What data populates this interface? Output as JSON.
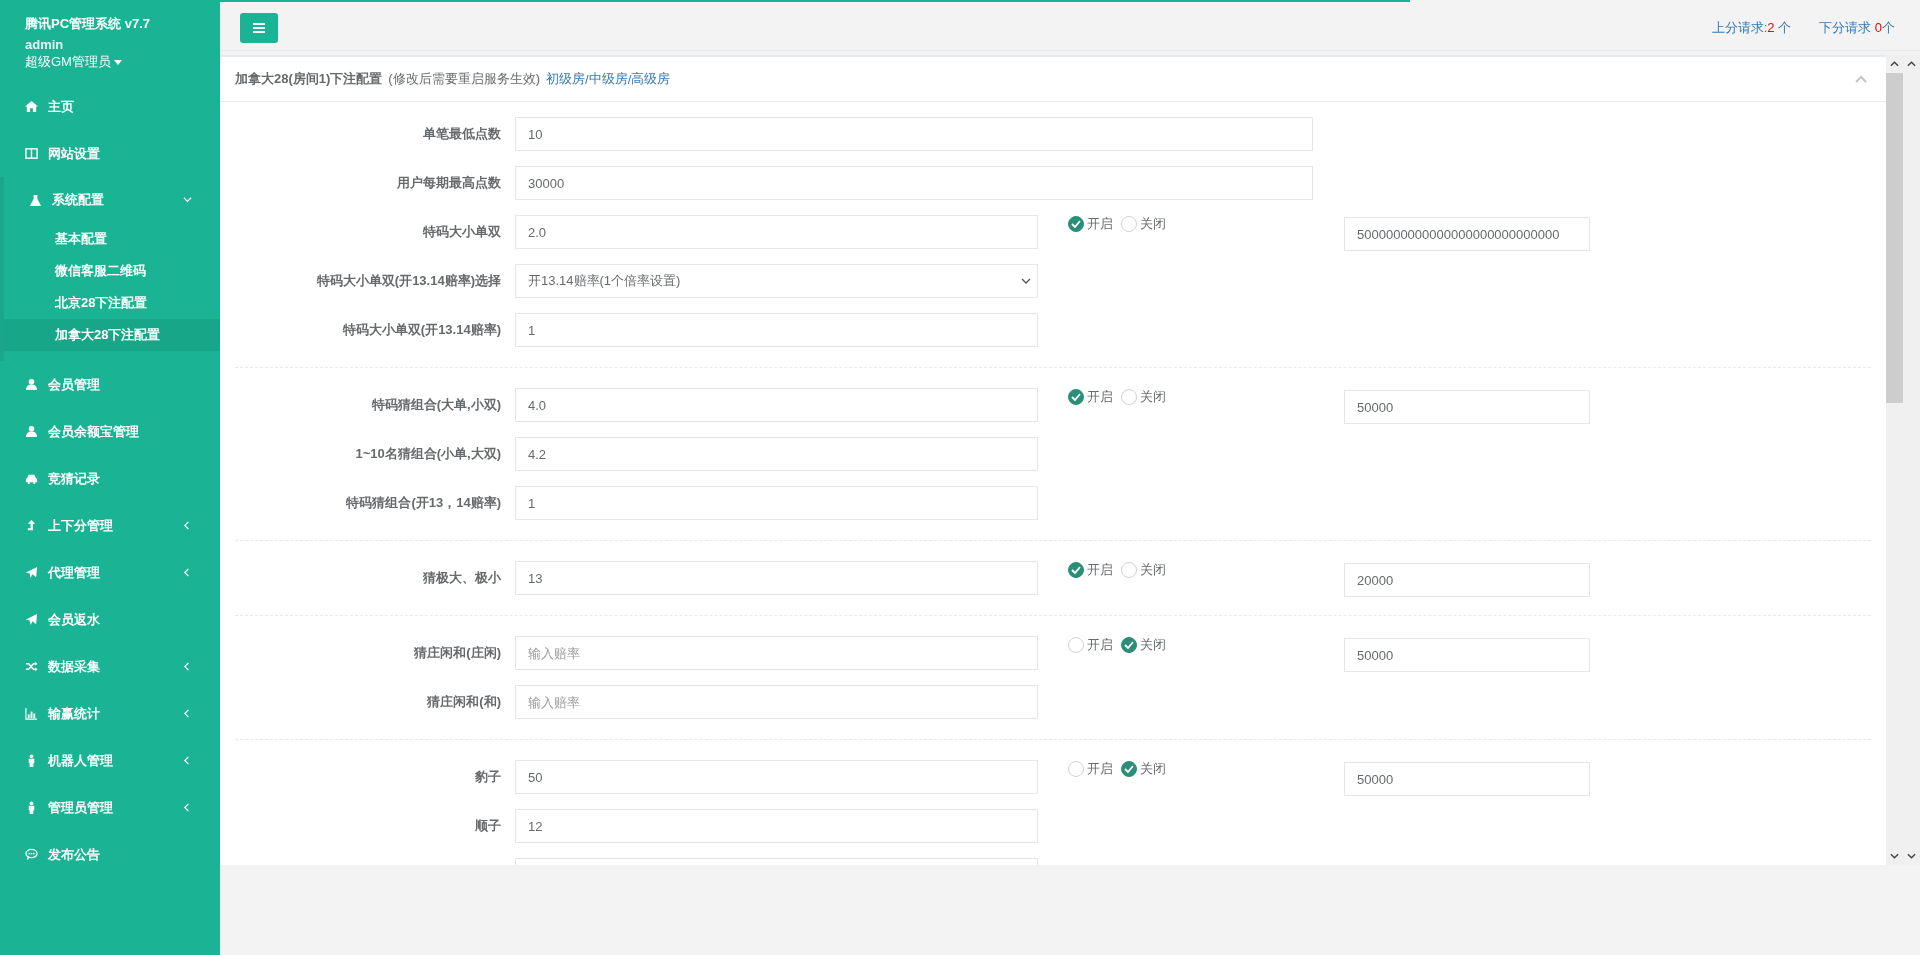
{
  "sidebar": {
    "brand": "腾讯PC管理系统 v7.7",
    "user": "admin",
    "role": "超级GM管理员",
    "items": [
      {
        "label": "主页",
        "selected": false
      },
      {
        "label": "网站设置",
        "selected": false
      },
      {
        "label": "系统配置",
        "selected": false,
        "expanded": true,
        "children": [
          {
            "label": "基本配置",
            "selected": false
          },
          {
            "label": "微信客服二维码",
            "selected": false
          },
          {
            "label": "北京28下注配置",
            "selected": false
          },
          {
            "label": "加拿大28下注配置",
            "selected": true
          }
        ]
      },
      {
        "label": "会员管理",
        "selected": false
      },
      {
        "label": "会员余额宝管理",
        "selected": false
      },
      {
        "label": "竞猜记录",
        "selected": false
      },
      {
        "label": "上下分管理",
        "selected": false,
        "expanded": false
      },
      {
        "label": "代理管理",
        "selected": false,
        "expanded": false
      },
      {
        "label": "会员返水",
        "selected": false
      },
      {
        "label": "数据采集",
        "selected": false,
        "expanded": false
      },
      {
        "label": "输赢统计",
        "selected": false,
        "expanded": false
      },
      {
        "label": "机器人管理",
        "selected": false,
        "expanded": false
      },
      {
        "label": "管理员管理",
        "selected": false,
        "expanded": false
      },
      {
        "label": "发布公告",
        "selected": false
      }
    ]
  },
  "topbar": {
    "loading_bar": {
      "level": 0.7
    },
    "requests": [
      {
        "label": "上分请求:",
        "count": "2",
        "unit": " 个"
      },
      {
        "label": "下分请求 ",
        "count": "0",
        "unit": "个"
      }
    ]
  },
  "panel": {
    "title": "加拿大28(房间1)下注配置",
    "note": "(修改后需要重启服务生效)",
    "separator": "/",
    "links": [
      "初级房",
      "中级房",
      "高级房"
    ],
    "sections": [
      {
        "rows": [
          {
            "kind": "wide-input",
            "label": "单笔最低点数",
            "value": "10"
          },
          {
            "kind": "wide-input",
            "label": "用户每期最高点数",
            "value": "30000"
          },
          {
            "kind": "input",
            "label": "特码大小单双",
            "value": "2.0",
            "options": [
              {
                "label": "开启",
                "selected": true
              },
              {
                "label": "关闭",
                "selected": false
              }
            ],
            "limit": "5000000000000000000000000000"
          },
          {
            "kind": "select",
            "label": "特码大小单双(开13.14赔率)选择",
            "value": "开13.14赔率(1个倍率设置)"
          },
          {
            "kind": "input",
            "label": "特码大小单双(开13.14赔率)",
            "value": "1"
          }
        ]
      },
      {
        "rows": [
          {
            "kind": "input",
            "label": "特码猜组合(大单,小双)",
            "value": "4.0",
            "options": [
              {
                "label": "开启",
                "selected": true
              },
              {
                "label": "关闭",
                "selected": false
              }
            ],
            "limit": "50000"
          },
          {
            "kind": "input",
            "label": "1~10名猜组合(小单,大双)",
            "value": "4.2"
          },
          {
            "kind": "input",
            "label": "特码猜组合(开13，14赔率)",
            "value": "1"
          }
        ]
      },
      {
        "rows": [
          {
            "kind": "input",
            "label": "猜极大、极小",
            "value": "13",
            "options": [
              {
                "label": "开启",
                "selected": true
              },
              {
                "label": "关闭",
                "selected": false
              }
            ],
            "limit": "20000"
          }
        ]
      },
      {
        "rows": [
          {
            "kind": "input",
            "label": "猜庄闲和(庄闲)",
            "placeholder": "输入赔率",
            "options": [
              {
                "label": "开启",
                "selected": false
              },
              {
                "label": "关闭",
                "selected": true
              }
            ],
            "limit": "50000"
          },
          {
            "kind": "input",
            "label": "猜庄闲和(和)",
            "placeholder": "输入赔率"
          }
        ]
      },
      {
        "rows": [
          {
            "kind": "input",
            "label": "豹子",
            "value": "50",
            "options": [
              {
                "label": "开启",
                "selected": false
              },
              {
                "label": "关闭",
                "selected": true
              }
            ],
            "limit": "50000"
          },
          {
            "kind": "input",
            "label": "顺子",
            "value": "12"
          },
          {
            "kind": "input"
          }
        ]
      }
    ]
  }
}
